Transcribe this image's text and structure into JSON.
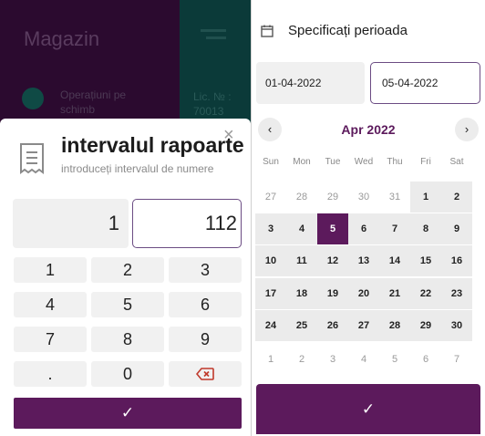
{
  "background_app": {
    "title": "Magazin",
    "operations_label": "Operațiuni pe schimb",
    "license_label": "Lic. № : 70013"
  },
  "range_dialog": {
    "close_icon": "×",
    "title": "intervalul rapoarte",
    "subtitle": "introduceți intervalul de numere",
    "from_value": "1",
    "to_value": "112",
    "keypad": [
      "1",
      "2",
      "3",
      "4",
      "5",
      "6",
      "7",
      "8",
      "9",
      ".",
      "0",
      "backspace"
    ],
    "confirm_icon": "✓"
  },
  "period_picker": {
    "header": "Specificați perioada",
    "start_date": "01-04-2022",
    "end_date": "05-04-2022",
    "prev_icon": "‹",
    "next_icon": "›",
    "month_label": "Apr 2022",
    "weekdays": [
      "Sun",
      "Mon",
      "Tue",
      "Wed",
      "Thu",
      "Fri",
      "Sat"
    ],
    "weeks": [
      [
        "27",
        "28",
        "29",
        "30",
        "31",
        "1",
        "2"
      ],
      [
        "3",
        "4",
        "5",
        "6",
        "7",
        "8",
        "9"
      ],
      [
        "10",
        "11",
        "12",
        "13",
        "14",
        "15",
        "16"
      ],
      [
        "17",
        "18",
        "19",
        "20",
        "21",
        "22",
        "23"
      ],
      [
        "24",
        "25",
        "26",
        "27",
        "28",
        "29",
        "30"
      ],
      [
        "1",
        "2",
        "3",
        "4",
        "5",
        "6",
        "7"
      ]
    ],
    "selected_day": "5",
    "confirm_icon": "✓"
  },
  "colors": {
    "accent": "#5c1a5c",
    "outline": "#6b4c83",
    "backspace": "#c0392b"
  }
}
